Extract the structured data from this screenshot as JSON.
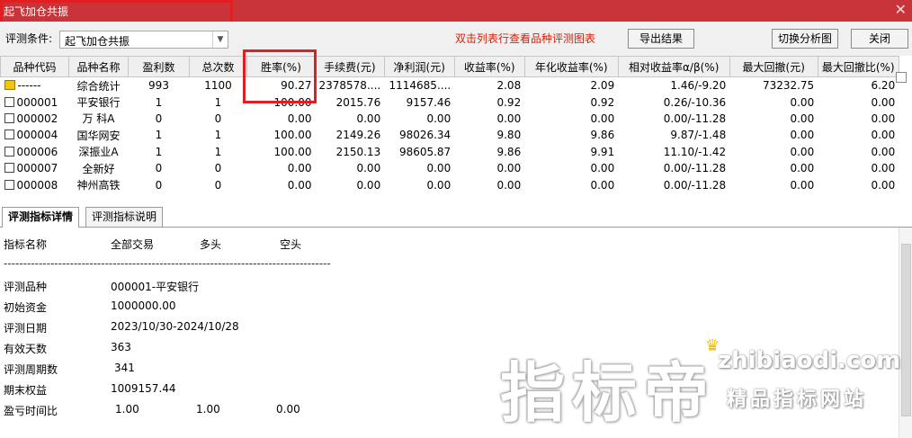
{
  "window": {
    "title": "起飞加仓共振",
    "close_glyph": "✕"
  },
  "toolbar": {
    "condition_label": "评测条件:",
    "condition_value": "起飞加仓共振",
    "hint": "双击列表行查看品种评测图表",
    "export_label": "导出结果",
    "switch_label": "切换分析图",
    "close_label": "关闭"
  },
  "table": {
    "headers": [
      "品种代码",
      "品种名称",
      "盈利数",
      "总次数",
      "胜率(%)",
      "手续费(元)",
      "净利润(元)",
      "收益率(%)",
      "年化收益率(%)",
      "相对收益率α/β(%)",
      "最大回撤(元)",
      "最大回撤比(%)"
    ],
    "rows": [
      {
        "icon": "summary-icon",
        "code": "------",
        "name": "综合统计",
        "wins": "993",
        "total": "1100",
        "winrate": "90.27",
        "fee": "2378578....",
        "net": "1114685....",
        "ret": "2.08",
        "annual": "2.09",
        "rel": "1.46/-9.20",
        "dd": "73232.75",
        "ddr": "6.20"
      },
      {
        "icon": "doc-icon",
        "code": "000001",
        "name": "平安银行",
        "wins": "1",
        "total": "1",
        "winrate": "100.00",
        "fee": "2015.76",
        "net": "9157.46",
        "ret": "0.92",
        "annual": "0.92",
        "rel": "0.26/-10.36",
        "dd": "0.00",
        "ddr": "0.00"
      },
      {
        "icon": "doc-icon",
        "code": "000002",
        "name": "万 科A",
        "wins": "0",
        "total": "0",
        "winrate": "0.00",
        "fee": "0.00",
        "net": "0.00",
        "ret": "0.00",
        "annual": "0.00",
        "rel": "0.00/-11.28",
        "dd": "0.00",
        "ddr": "0.00"
      },
      {
        "icon": "doc-icon",
        "code": "000004",
        "name": "国华网安",
        "wins": "1",
        "total": "1",
        "winrate": "100.00",
        "fee": "2149.26",
        "net": "98026.34",
        "ret": "9.80",
        "annual": "9.86",
        "rel": "9.87/-1.48",
        "dd": "0.00",
        "ddr": "0.00"
      },
      {
        "icon": "doc-icon",
        "code": "000006",
        "name": "深振业A",
        "wins": "1",
        "total": "1",
        "winrate": "100.00",
        "fee": "2150.13",
        "net": "98605.87",
        "ret": "9.86",
        "annual": "9.91",
        "rel": "11.10/-1.42",
        "dd": "0.00",
        "ddr": "0.00"
      },
      {
        "icon": "doc-icon",
        "code": "000007",
        "name": "全新好",
        "wins": "0",
        "total": "0",
        "winrate": "0.00",
        "fee": "0.00",
        "net": "0.00",
        "ret": "0.00",
        "annual": "0.00",
        "rel": "0.00/-11.28",
        "dd": "0.00",
        "ddr": "0.00"
      },
      {
        "icon": "doc-icon",
        "code": "000008",
        "name": "神州高铁",
        "wins": "0",
        "total": "0",
        "winrate": "0.00",
        "fee": "0.00",
        "net": "0.00",
        "ret": "0.00",
        "annual": "0.00",
        "rel": "0.00/-11.28",
        "dd": "0.00",
        "ddr": "0.00"
      }
    ]
  },
  "tabs": {
    "detail": "评测指标详情",
    "explain": "评测指标说明"
  },
  "detail": {
    "header": {
      "name": "指标名称",
      "all": "全部交易",
      "long": "多头",
      "short": "空头"
    },
    "divider": "------------------------------------------------------------------------------------",
    "items": [
      {
        "label": "评测品种",
        "value": "000001-平安银行"
      },
      {
        "label": "初始资金",
        "value": "1000000.00"
      },
      {
        "label": "评测日期",
        "value": "2023/10/30-2024/10/28"
      },
      {
        "label": "有效天数",
        "value": "363"
      },
      {
        "label": "评测周期数",
        "value": "341"
      },
      {
        "label": "期末权益",
        "value": "1009157.44"
      }
    ],
    "ratio": {
      "label": "盈亏时间比",
      "all": "1.00",
      "long": "1.00",
      "short": "0.00"
    }
  },
  "watermark": {
    "brand": "指标帝",
    "url": "zhibiaodi.com",
    "slogan": "精品指标网站"
  },
  "colors": {
    "title_bar": "#c8343a",
    "highlight": "#e02020",
    "hint": "#d81e06"
  }
}
